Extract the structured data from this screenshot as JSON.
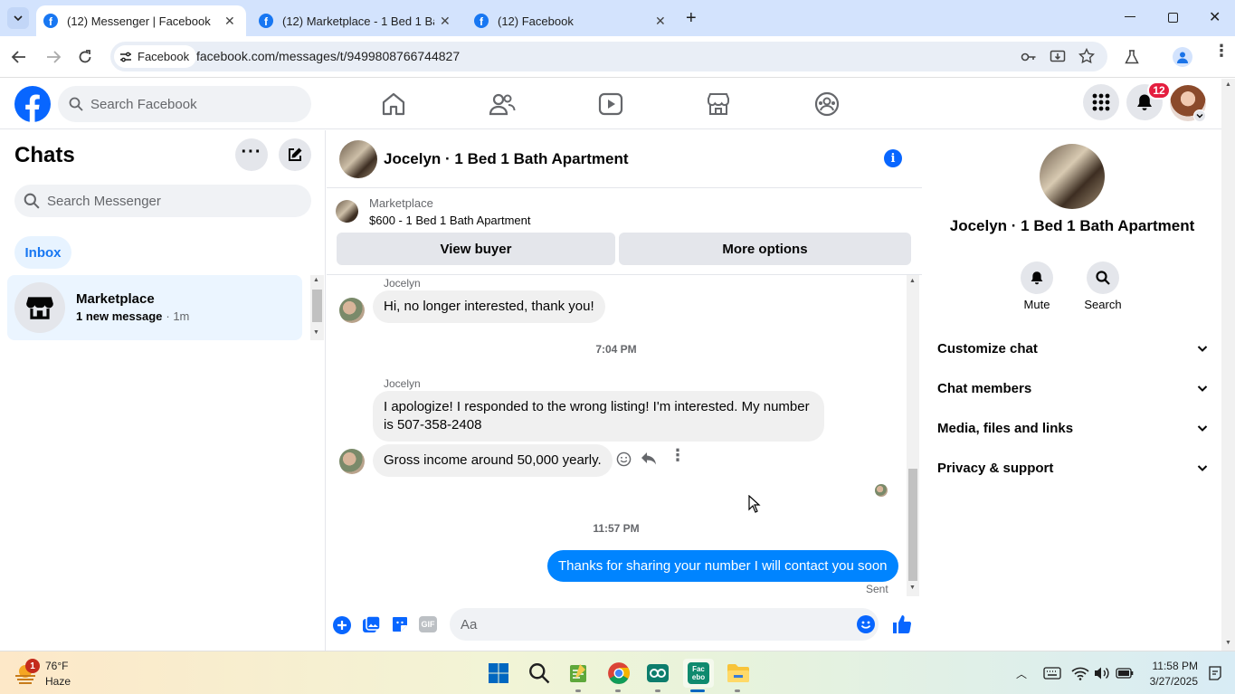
{
  "browser": {
    "tabs": [
      {
        "label": "(12) Messenger | Facebook",
        "active": true
      },
      {
        "label": "(12) Marketplace - 1 Bed 1 Bath",
        "active": false
      },
      {
        "label": "(12) Facebook",
        "active": false
      }
    ],
    "site_chip": "Facebook",
    "url": "facebook.com/messages/t/9499808766744827"
  },
  "fb_header": {
    "search_placeholder": "Search Facebook",
    "notification_count": "12",
    "brand_color": "#1877f2"
  },
  "chats_panel": {
    "title": "Chats",
    "search_placeholder": "Search Messenger",
    "inbox_label": "Inbox",
    "conversations": [
      {
        "name": "Marketplace",
        "preview": "1 new message",
        "time": "· 1m",
        "icon": "marketplace-store-icon"
      }
    ]
  },
  "chat": {
    "title": "Jocelyn · 1 Bed 1 Bath Apartment",
    "marketplace_label": "Marketplace",
    "listing": "$600 - 1 Bed 1 Bath Apartment",
    "view_buyer": "View buyer",
    "more_options": "More options",
    "messages": [
      {
        "sender": "Jocelyn",
        "text": "Hi, no longer interested, thank you!"
      },
      {
        "timestamp": "7:04 PM"
      },
      {
        "sender": "Jocelyn",
        "text": "I apologize! I responded to the wrong listing! I'm interested. My number is 507-358-2408"
      },
      {
        "text": "Gross income around 50,000 yearly."
      },
      {
        "timestamp": "11:57 PM"
      },
      {
        "outgoing": true,
        "text": "Thanks for sharing your number I will contact you soon",
        "status": "Sent"
      }
    ],
    "composer_placeholder": "Aa"
  },
  "info_panel": {
    "name": "Jocelyn · 1 Bed 1 Bath Apartment",
    "actions": [
      {
        "label": "Mute",
        "icon": "bell-icon"
      },
      {
        "label": "Search",
        "icon": "search-icon"
      }
    ],
    "sections": [
      "Customize chat",
      "Chat members",
      "Media, files and links",
      "Privacy & support"
    ]
  },
  "taskbar": {
    "weather_temp": "76°F",
    "weather_desc": "Haze",
    "weather_badge": "1",
    "time": "11:58 PM",
    "date": "3/27/2025"
  }
}
